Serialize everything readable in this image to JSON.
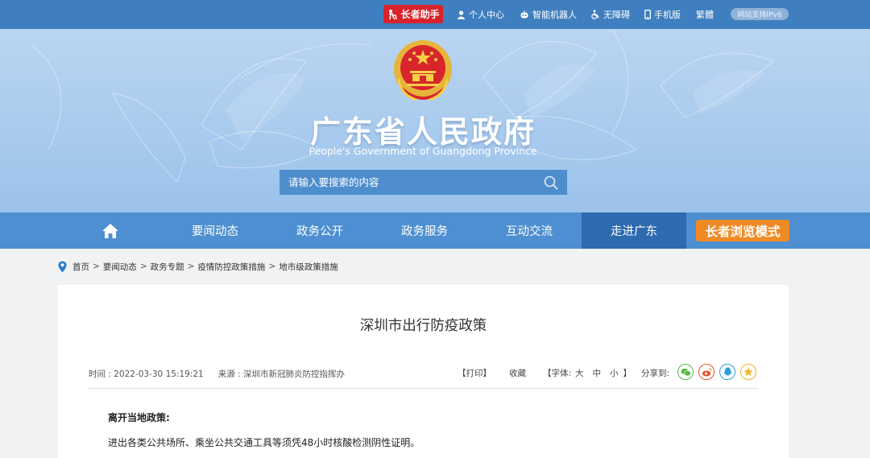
{
  "topbar": {
    "elder_helper": "长者助手",
    "personal_center": "个人中心",
    "smart_robot": "智能机器人",
    "accessibility": "无障碍",
    "mobile": "手机版",
    "traditional": "繁體",
    "ipv6": "网站支持IPv6"
  },
  "header": {
    "title": "广东省人民政府",
    "subtitle": "People's Government of Guangdong Province"
  },
  "search": {
    "placeholder": "请输入要搜索的内容"
  },
  "nav": {
    "items": [
      {
        "label": "要闻动态"
      },
      {
        "label": "政务公开"
      },
      {
        "label": "政务服务"
      },
      {
        "label": "互动交流"
      },
      {
        "label": "走进广东"
      }
    ],
    "active_index": 4,
    "elder_mode": "长者浏览模式"
  },
  "breadcrumb": [
    "首页",
    "要闻动态",
    "政务专题",
    "疫情防控政策措施",
    "地市级政策措施"
  ],
  "breadcrumb_sep": ">",
  "article": {
    "title": "深圳市出行防疫政策",
    "time": "时间 : 2022-03-30 15:19:21",
    "source": "来源 : 深圳市新冠肺炎防控指挥办",
    "print": "【打印】",
    "favorite": "收藏",
    "font_label": "【字体:",
    "font_large": "大",
    "font_medium": "中",
    "font_small": "小",
    "font_end": "】",
    "share_label": "分享到:",
    "section_heading": "离开当地政策:",
    "paragraph": "进出各类公共场所、乘坐公共交通工具等须凭48小时核酸检测阴性证明。"
  },
  "colors": {
    "topbar": "#3f7fc0",
    "nav": "#4d8fd0",
    "nav_active": "#2d6ab0",
    "elder_red": "#d9232a",
    "elder_orange": "#f08a24",
    "wechat": "#58b946",
    "weibo": "#e0532b",
    "qq": "#2a9fd6",
    "qzone": "#f0b428"
  }
}
